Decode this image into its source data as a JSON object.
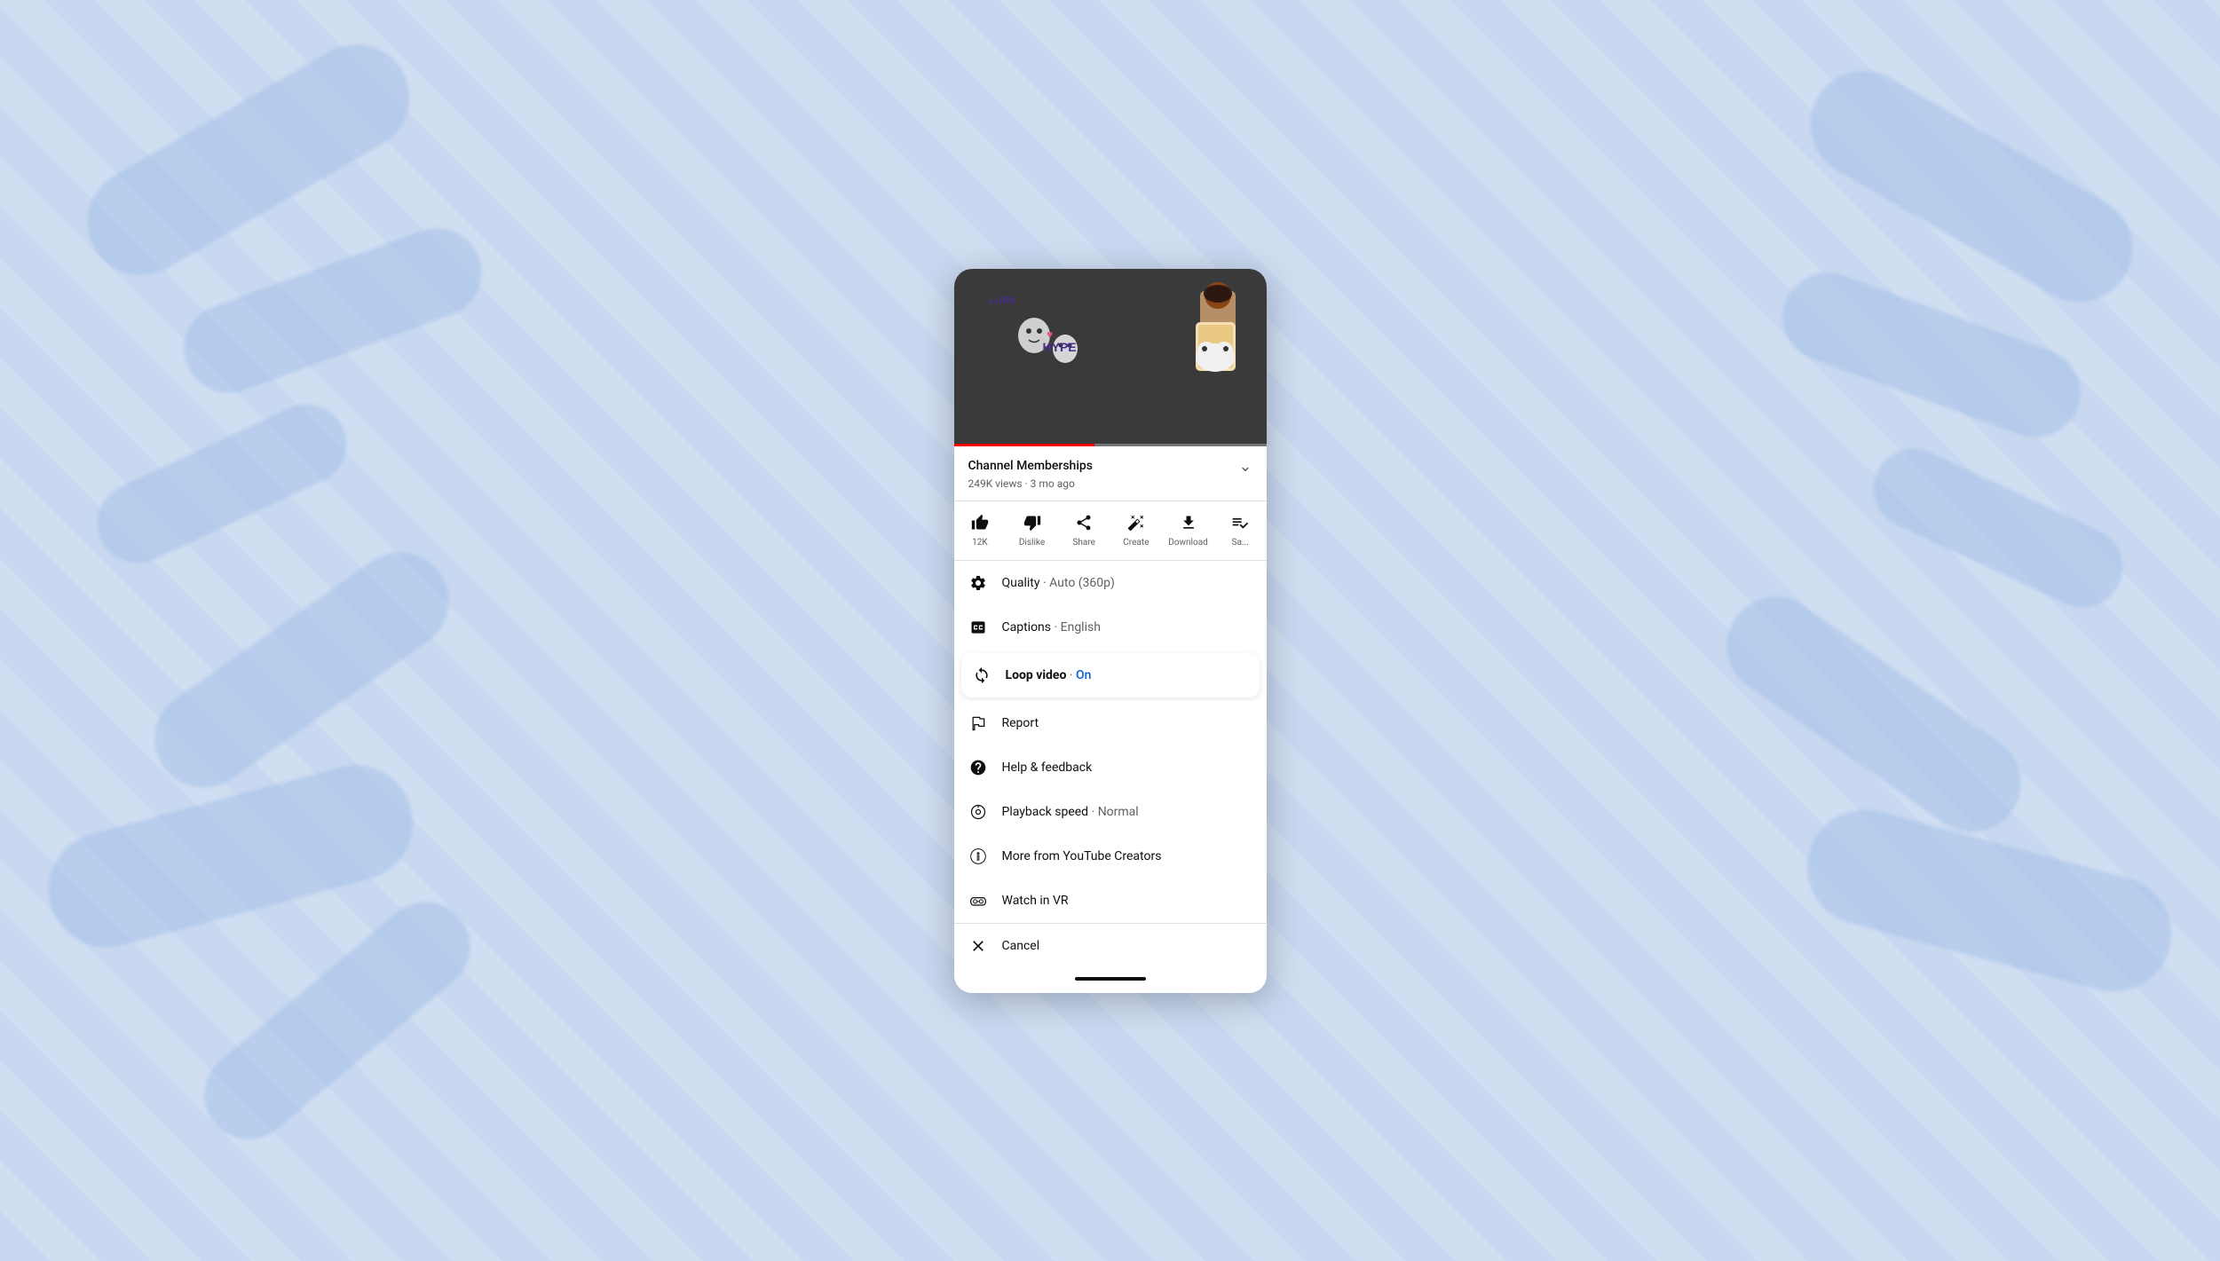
{
  "background": {
    "color": "#c8d8f0"
  },
  "video": {
    "title": "Channel Memberships",
    "views": "249K views",
    "time_ago": "3 mo ago",
    "meta": "249K views · 3 mo ago",
    "progress_percent": 45
  },
  "actions": {
    "like_label": "12K",
    "dislike_label": "Dislike",
    "share_label": "Share",
    "create_label": "Create",
    "download_label": "Download",
    "save_label": "Sa..."
  },
  "menu": {
    "quality_label": "Quality",
    "quality_value": "Auto (360p)",
    "captions_label": "Captions",
    "captions_value": "English",
    "loop_label": "Loop video",
    "loop_value": "On",
    "report_label": "Report",
    "help_label": "Help & feedback",
    "playback_label": "Playback speed",
    "playback_value": "Normal",
    "more_label": "More from YouTube Creators",
    "vr_label": "Watch in VR",
    "cancel_label": "Cancel"
  }
}
